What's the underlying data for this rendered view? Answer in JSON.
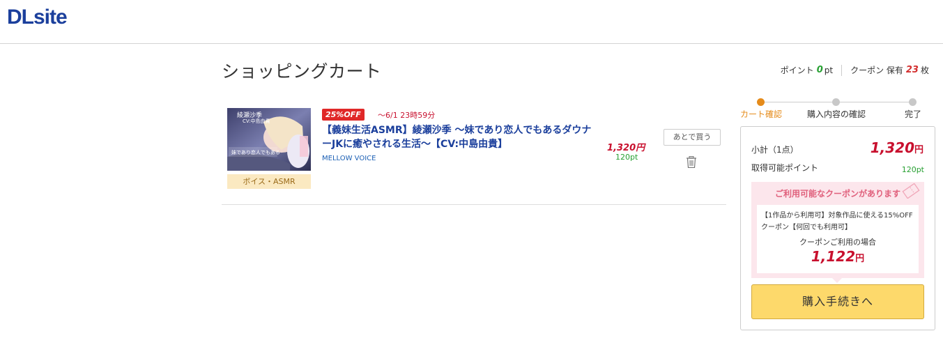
{
  "header": {
    "logo": "DLsite"
  },
  "page": {
    "title": "ショッピングカート"
  },
  "user": {
    "points_label": "ポイント",
    "points_value": "0",
    "points_unit": "pt",
    "coupon_label": "クーポン 保有",
    "coupon_count": "23",
    "coupon_unit": "枚"
  },
  "cart_item": {
    "genre": "ボイス・ASMR",
    "discount_badge": "25%OFF",
    "sale_end": "〜6/1 23時59分",
    "title": "【義妹生活ASMR】綾瀬沙季 〜妹であり恋人でもあるダウナーJKに癒やされる生活〜【CV:中島由貴】",
    "maker": "MELLOW VOICE",
    "price": "1,320円",
    "points": "120pt",
    "later_button": "あとで買う",
    "thumb_text_1": "綾瀬沙季",
    "thumb_text_2": "CV:中島由貴"
  },
  "steps": [
    {
      "label": "カート確認",
      "active": true
    },
    {
      "label": "購入内容の確認",
      "active": false
    },
    {
      "label": "完了",
      "active": false
    }
  ],
  "summary": {
    "subtotal_label": "小計（1点）",
    "subtotal_value": "1,320",
    "subtotal_unit": "円",
    "points_label": "取得可能ポイント",
    "points_value": "120pt",
    "coupon_title": "ご利用可能なクーポンがあります",
    "coupon_desc": "【1作品から利用可】対象作品に使える15%OFFクーポン【何回でも利用可】",
    "coupon_case": "クーポンご利用の場合",
    "coupon_price": "1,122",
    "coupon_unit": "円",
    "buy_button": "購入手続きへ"
  },
  "colors": {
    "brand": "#1b3f9c",
    "accent": "#e58b1a",
    "price": "#c8102e",
    "points": "#27a032",
    "buy_button": "#fdd96b"
  }
}
